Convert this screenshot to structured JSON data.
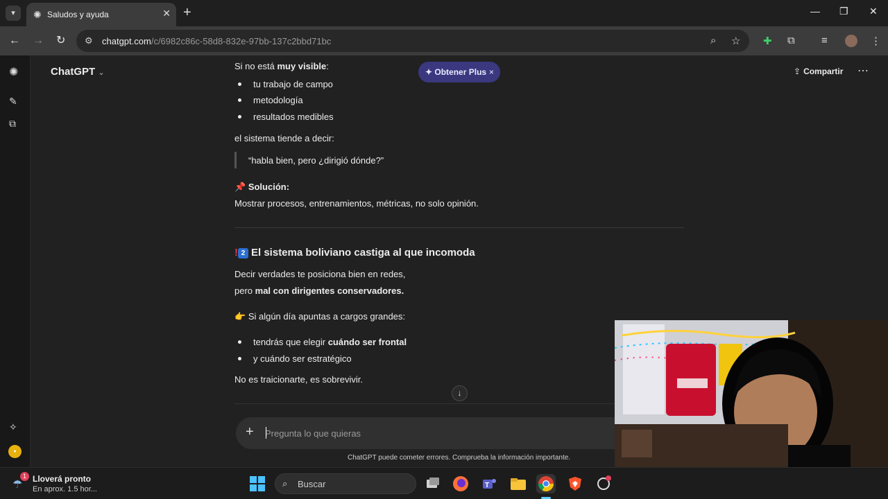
{
  "browser": {
    "tab_title": "Saludos y ayuda",
    "url_domain": "chatgpt.com",
    "url_path": "/c/6982c86c-58d8-832e-97bb-137c2bbd71bc"
  },
  "header": {
    "model_name": "ChatGPT",
    "promo_label": "✦ Obtener Plus",
    "share_label": "Compartir"
  },
  "message": {
    "intro_prefix": "Si no está ",
    "intro_bold": "muy visible",
    "intro_suffix": ":",
    "bullets1": [
      "tu trabajo de campo",
      "metodología",
      "resultados medibles"
    ],
    "system_says": "el sistema tiende a decir:",
    "quote": "“habla bien, pero ¿dirigió dónde?”",
    "solution_label": "Solución:",
    "solution_text": "Mostrar procesos, entrenamientos, métricas, no solo opinión.",
    "section_number": "2",
    "section_title": "El sistema boliviano castiga al que incomoda",
    "para_line1": "Decir verdades te posiciona bien en redes,",
    "para_line2_prefix": "pero ",
    "para_line2_bold": "mal con dirigentes conservadores.",
    "tip_text": "Si algún día apuntas a cargos grandes:",
    "bullet2_1_prefix": "tendrás que elegir ",
    "bullet2_1_bold": "cuándo ser frontal",
    "bullet2_2": "y cuándo ser estratégico",
    "closing": "No es traicionarte, es sobrevivir."
  },
  "composer": {
    "placeholder": "Pregunta lo que quieras"
  },
  "disclaimer": "ChatGPT puede cometer errores. Comprueba la información importante.",
  "taskbar": {
    "weather_title": "Lloverá pronto",
    "weather_sub": "En aprox. 1.5 hor...",
    "weather_badge": "1",
    "search_label": "Buscar"
  },
  "colors": {
    "accent_blue": "#60cdff",
    "promo_bg": "#3b3880"
  }
}
